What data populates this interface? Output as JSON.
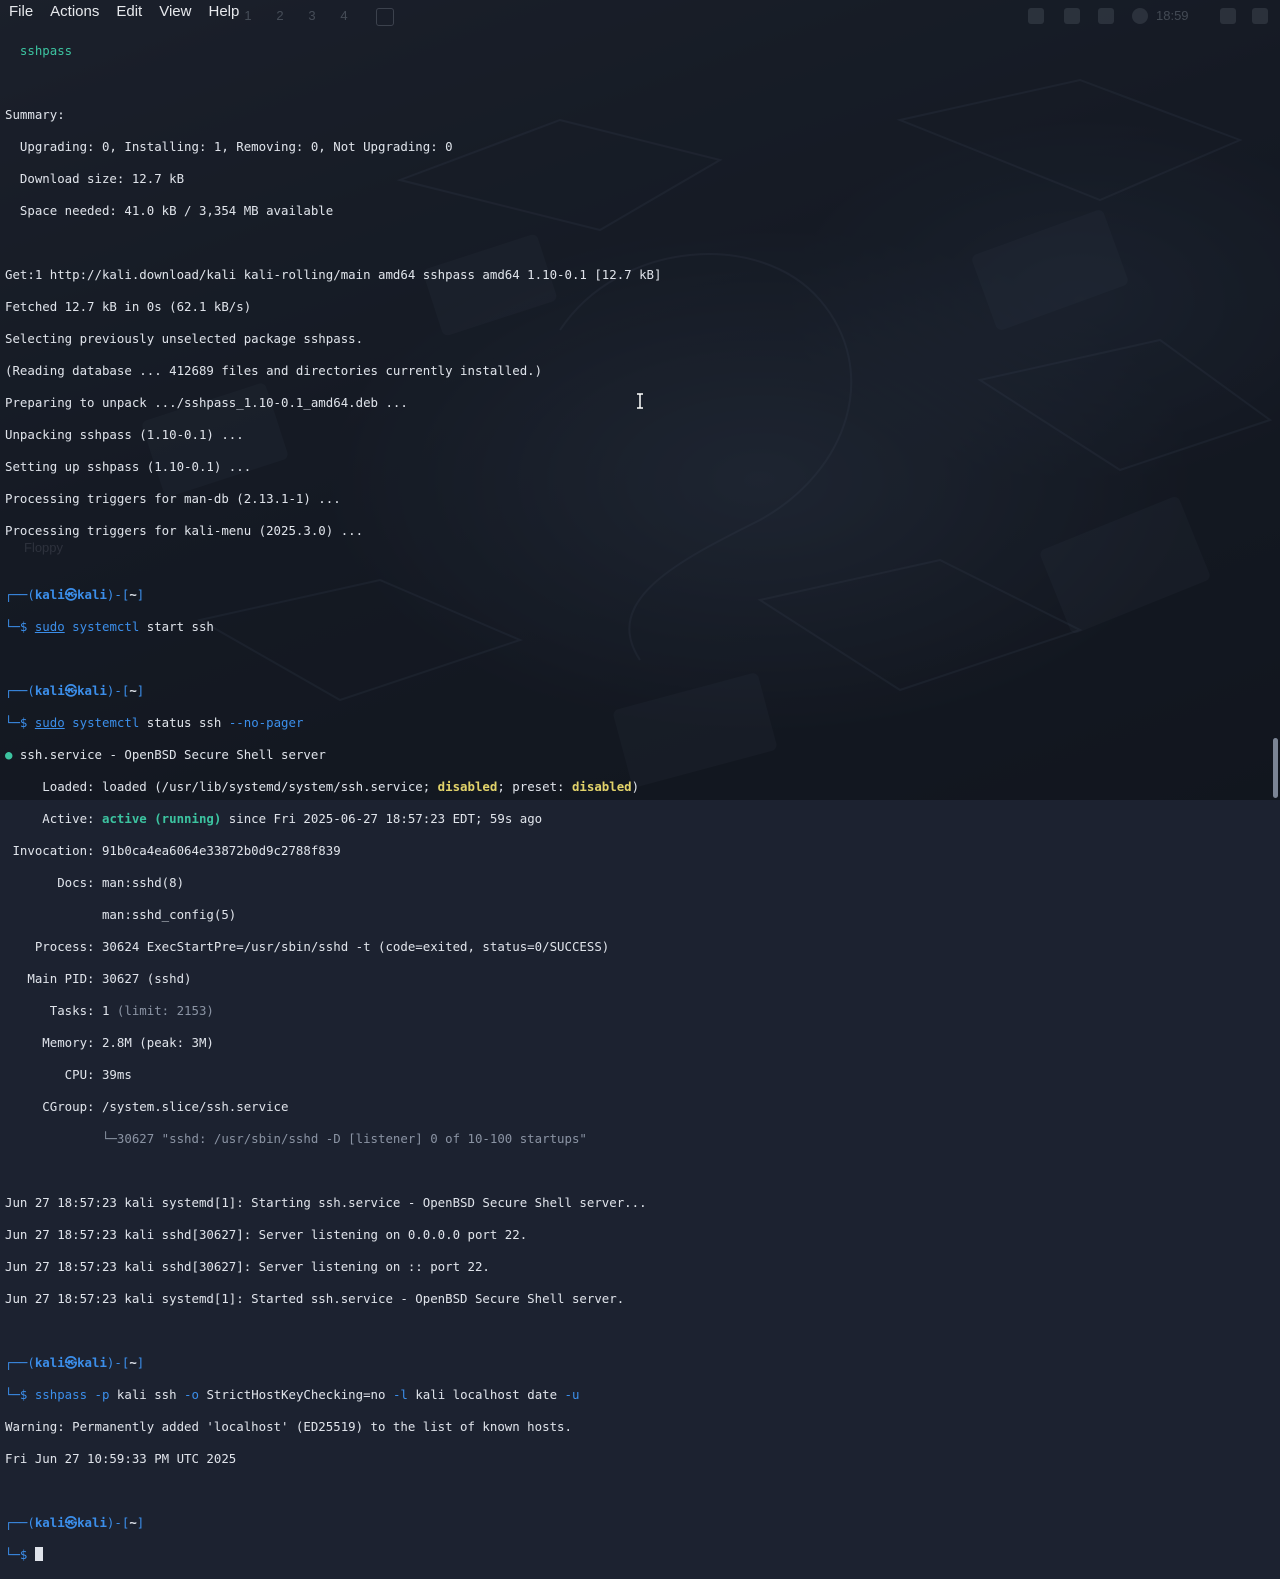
{
  "menubar": {
    "items": [
      "File",
      "Actions",
      "Edit",
      "View",
      "Help"
    ]
  },
  "panel": {
    "workspaces": [
      "1",
      "2",
      "3",
      "4"
    ],
    "clock": "18:59"
  },
  "desktop": {
    "icon_label": "Floppy"
  },
  "terminal": {
    "pkg_line": "  sshpass",
    "summary": [
      "Summary:",
      "  Upgrading: 0, Installing: 1, Removing: 0, Not Upgrading: 0",
      "  Download size: 12.7 kB",
      "  Space needed: 41.0 kB / 3,354 MB available"
    ],
    "apt_output": [
      "Get:1 http://kali.download/kali kali-rolling/main amd64 sshpass amd64 1.10-0.1 [12.7 kB]",
      "Fetched 12.7 kB in 0s (62.1 kB/s)",
      "Selecting previously unselected package sshpass.",
      "(Reading database ... 412689 files and directories currently installed.)",
      "Preparing to unpack .../sshpass_1.10-0.1_amd64.deb ...",
      "Unpacking sshpass (1.10-0.1) ...",
      "Setting up sshpass (1.10-0.1) ...",
      "Processing triggers for man-db (2.13.1-1) ...",
      "Processing triggers for kali-menu (2025.3.0) ..."
    ],
    "prompt": {
      "top_left": "┌──(",
      "user": "kali",
      "at": "㉿",
      "host": "kali",
      "mid": ")-[",
      "dir": "~",
      "end": "]",
      "bottom": "└─$ "
    },
    "cmd1": {
      "sudo": "sudo",
      "prog": "systemctl",
      "rest": " start ssh"
    },
    "cmd2": {
      "sudo": "sudo",
      "prog": "systemctl",
      "rest": " status ssh ",
      "flag": "--no-pager"
    },
    "status": {
      "bullet": "●",
      "title": " ssh.service - OpenBSD Secure Shell server",
      "loaded_prefix": "     Loaded: loaded (/usr/lib/systemd/system/ssh.service; ",
      "loaded_disabled": "disabled",
      "loaded_mid": "; preset: ",
      "preset_disabled": "disabled",
      "loaded_end": ")",
      "active_prefix": "     Active: ",
      "active_state": "active (running)",
      "active_rest": " since Fri 2025-06-27 18:57:23 EDT; 59s ago",
      "invocation": " Invocation: 91b0ca4ea6064e33872b0d9c2788f839",
      "docs1": "       Docs: man:sshd(8)",
      "docs2": "             man:sshd_config(5)",
      "process": "    Process: 30624 ExecStartPre=/usr/sbin/sshd -t (code=exited, status=0/SUCCESS)",
      "mainpid": "   Main PID: 30627 (sshd)",
      "tasks_prefix": "      Tasks: 1 ",
      "tasks_limit": "(limit: 2153)",
      "memory": "     Memory: 2.8M (peak: 3M)",
      "cpu": "        CPU: 39ms",
      "cgroup": "     CGroup: /system.slice/ssh.service",
      "cgroup_child": "             └─30627 \"sshd: /usr/sbin/sshd -D [listener] 0 of 10-100 startups\""
    },
    "journal": [
      "Jun 27 18:57:23 kali systemd[1]: Starting ssh.service - OpenBSD Secure Shell server...",
      "Jun 27 18:57:23 kali sshd[30627]: Server listening on 0.0.0.0 port 22.",
      "Jun 27 18:57:23 kali sshd[30627]: Server listening on :: port 22.",
      "Jun 27 18:57:23 kali systemd[1]: Started ssh.service - OpenBSD Secure Shell server."
    ],
    "cmd3": {
      "prog": "sshpass",
      "f1": " -p",
      "a1": " kali ssh",
      "f2": " -o",
      "a2": " StrictHostKeyChecking=no",
      "f3": " -l",
      "a3": " kali localhost date",
      "f4": " -u"
    },
    "ssh_output": [
      "Warning: Permanently added 'localhost' (ED25519) to the list of known hosts.",
      "Fri Jun 27 10:59:33 PM UTC 2025"
    ]
  },
  "colors": {
    "prompt_blue": "#3b8eea",
    "active_green": "#3cc3a0",
    "disabled_yellow": "#e2d36a",
    "text": "#dfe3ea"
  }
}
